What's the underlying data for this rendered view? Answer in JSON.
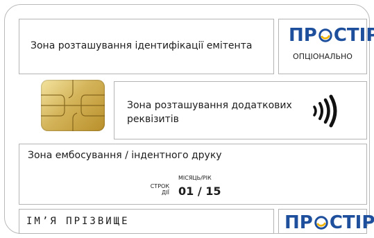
{
  "issuer_zone": {
    "label": "Зона розташування ідентифікації емітента"
  },
  "brand": {
    "logo_text_left": "ПР",
    "logo_text_right": "СТІР",
    "optional_label": "ОПЦІОНАЛЬНО",
    "color": "#1e4f9c",
    "accent": "#f0b400"
  },
  "extra_zone": {
    "line1": "Зона розташування додаткових",
    "line2": "реквізитів",
    "icon": "contactless-icon"
  },
  "emboss_zone": {
    "label": "Зона ембосування / індентного друку",
    "month_year_label": "МІСЯЦЬ/РІК",
    "valid_label_1": "СТРОК",
    "valid_label_2": "ДІЇ",
    "expiry": "01 / 15"
  },
  "cardholder": {
    "name": "ІМ’Я ПРІЗВИЩЕ"
  },
  "chip": {
    "icon": "emv-chip-icon"
  }
}
